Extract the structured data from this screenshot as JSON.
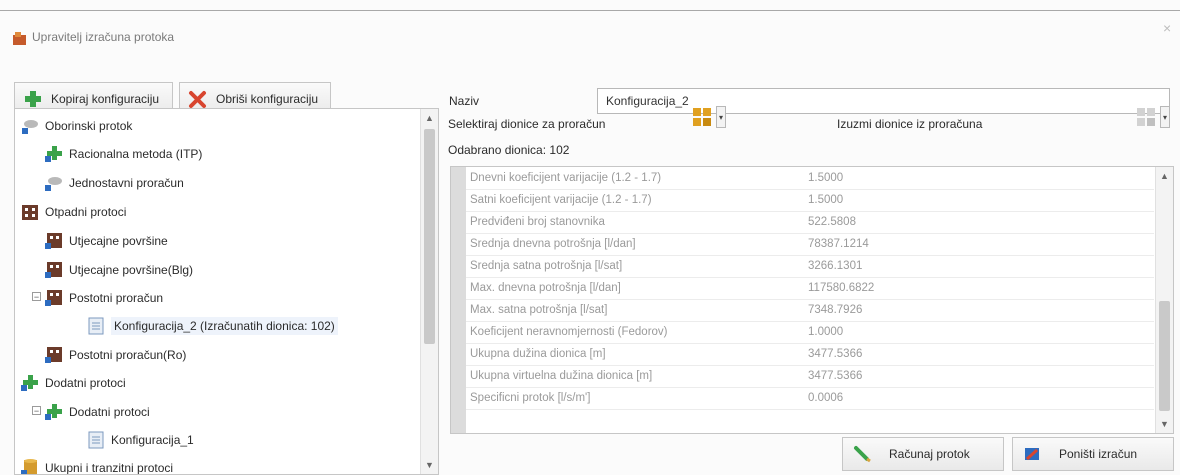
{
  "window": {
    "title": "Upravitelj izračuna protoka",
    "close_icon": "×"
  },
  "toolbar": {
    "copy_label": "Kopiraj konfiguraciju",
    "delete_label": "Obriši konfiguraciju"
  },
  "tree": {
    "items": [
      {
        "label": "Oborinski protok"
      },
      {
        "label": "Racionalna metoda (ITP)"
      },
      {
        "label": "Jednostavni proračun"
      },
      {
        "label": "Otpadni protoci"
      },
      {
        "label": "Utjecajne površine"
      },
      {
        "label": "Utjecajne površine(Blg)"
      },
      {
        "label": "Postotni proračun"
      },
      {
        "label": "Konfiguracija_2 (Izračunatih dionica: 102)"
      },
      {
        "label": "Postotni proračun(Ro)"
      },
      {
        "label": "Dodatni protoci"
      },
      {
        "label": "Dodatni protoci"
      },
      {
        "label": "Konfiguracija_1"
      },
      {
        "label": "Ukupni i tranzitni protoci"
      }
    ]
  },
  "form": {
    "name_label": "Naziv",
    "name_value": "Konfiguracija_2",
    "select_label": "Selektiraj dionice za proračun",
    "exclude_label": "Izuzmi dionice iz proračuna",
    "selected_count": "Odabrano dionica: 102"
  },
  "grid": {
    "rows": [
      {
        "key": "Dnevni koeficijent varijacije (1.2 - 1.7)",
        "value": "1.5000"
      },
      {
        "key": "Satni koeficijent varijacije (1.2 - 1.7)",
        "value": "1.5000"
      },
      {
        "key": "Predviđeni broj stanovnika",
        "value": "522.5808"
      },
      {
        "key": "Srednja dnevna potrošnja [l/dan]",
        "value": "78387.1214"
      },
      {
        "key": "Srednja satna potrošnja [l/sat]",
        "value": "3266.1301"
      },
      {
        "key": "Max. dnevna potrošnja [l/dan]",
        "value": "117580.6822"
      },
      {
        "key": "Max. satna potrošnja [l/sat]",
        "value": "7348.7926"
      },
      {
        "key": "Koeficijent neravnomjernosti (Fedorov)",
        "value": "1.0000"
      },
      {
        "key": "Ukupna dužina dionica [m]",
        "value": "3477.5366"
      },
      {
        "key": "Ukupna virtuelna dužina dionica [m]",
        "value": "3477.5366"
      },
      {
        "key": "Specificni protok [l/s/m']",
        "value": "0.0006"
      }
    ]
  },
  "actions": {
    "compute_label": "Računaj protok",
    "cancel_label": "Poništi izračun"
  },
  "colors": {
    "green": "#3aa24a",
    "red": "#d8452f",
    "brown": "#6b3b2a",
    "blue": "#2d6cc0",
    "gold": "#e0a020"
  }
}
